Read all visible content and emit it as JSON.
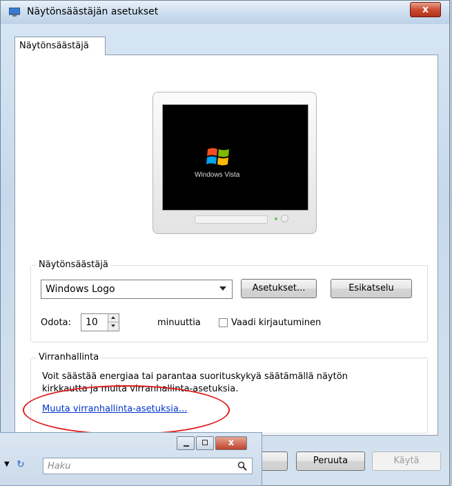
{
  "window": {
    "title": "Näytönsäästäjän asetukset",
    "close_label": "x"
  },
  "tabs": [
    {
      "label": "Näytönsäästäjä"
    }
  ],
  "preview": {
    "brand_text": "Windows Vista"
  },
  "screensaver": {
    "group_label": "Näytönsäästäjä",
    "selected": "Windows Logo",
    "settings_button": "Asetukset...",
    "preview_button": "Esikatselu",
    "wait_label": "Odota:",
    "wait_value": "10",
    "minutes_label": "minuuttia",
    "require_login_label": "Vaadi kirjautuminen",
    "require_login_checked": false
  },
  "power": {
    "group_label": "Virranhallinta",
    "description_line1": "Voit säästää energiaa tai parantaa suorituskykyä säätämällä näytön",
    "description_line2": "kirkkautta ja muita virranhallinta-asetuksia.",
    "link": "Muuta virranhallinta-asetuksia..."
  },
  "footer": {
    "cancel_button": "Peruuta",
    "apply_button": "Käytä"
  },
  "overlay_window": {
    "search_placeholder": "Haku",
    "close_label": "x"
  },
  "colors": {
    "annotation_oval": "#e01a1a",
    "link": "#0033cc"
  }
}
